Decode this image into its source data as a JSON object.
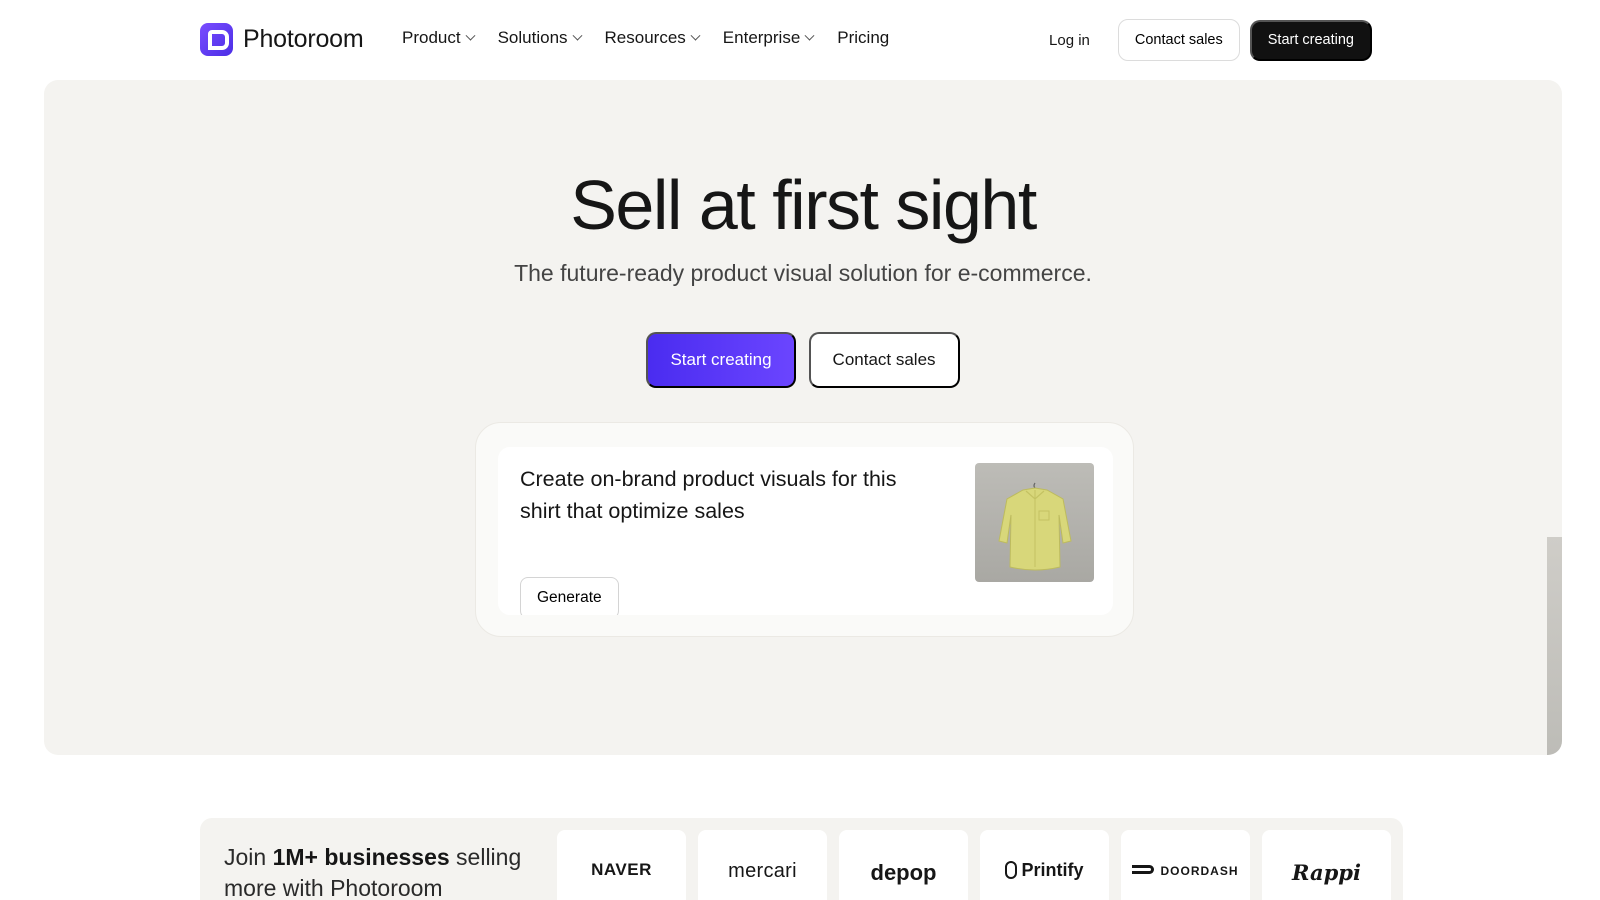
{
  "nav": {
    "brand": "Photoroom",
    "menu": [
      {
        "label": "Product",
        "has_dropdown": true
      },
      {
        "label": "Solutions",
        "has_dropdown": true
      },
      {
        "label": "Resources",
        "has_dropdown": true
      },
      {
        "label": "Enterprise",
        "has_dropdown": true
      },
      {
        "label": "Pricing",
        "has_dropdown": false
      }
    ],
    "login": "Log in",
    "contact_sales": "Contact sales",
    "start_creating": "Start creating"
  },
  "hero": {
    "title": "Sell at first sight",
    "subtitle": "The future-ready product visual solution for e-commerce.",
    "cta_primary": "Start creating",
    "cta_secondary": "Contact sales",
    "prompt": {
      "text": "Create on-brand product visuals for this shirt that optimize sales",
      "button": "Generate",
      "thumbnail": "yellow-shirt-image"
    }
  },
  "proof": {
    "prefix": "Join ",
    "highlight": "1M+ businesses",
    "suffix": " selling more with Photoroom",
    "brands": [
      "NAVER",
      "mercari",
      "depop",
      "Printify",
      "DOORDASH",
      "Rappi"
    ]
  },
  "colors": {
    "primary": "#4a2cf0",
    "primary_end": "#6b45ff",
    "hero_bg": "#f4f3f0",
    "dark_button": "#111111"
  }
}
